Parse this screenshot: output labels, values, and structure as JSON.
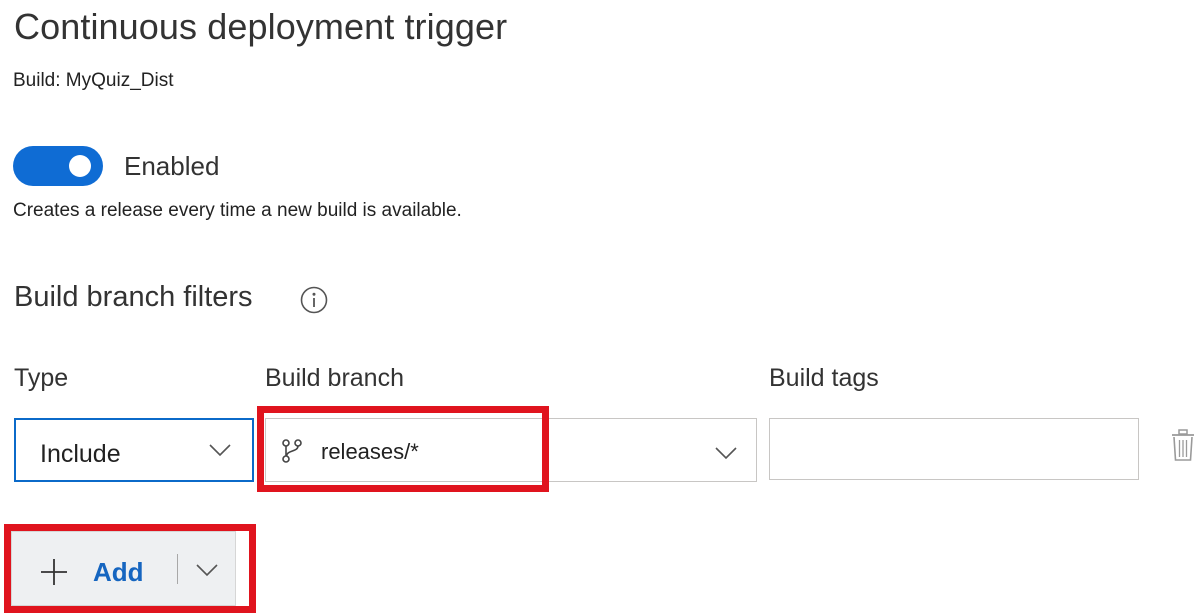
{
  "page": {
    "title": "Continuous deployment trigger",
    "subtitle": "Build: MyQuiz_Dist"
  },
  "trigger": {
    "enabled": true,
    "toggle_label": "Enabled",
    "description": "Creates a release every time a new build is available."
  },
  "filters": {
    "section_title": "Build branch filters",
    "info_icon": "info-icon",
    "columns": {
      "type": "Type",
      "branch": "Build branch",
      "tags": "Build tags"
    },
    "row": {
      "type_value": "Include",
      "branch_value": "releases/*",
      "branch_icon": "git-branch-icon",
      "tags_value": "",
      "delete_icon": "trash-icon"
    }
  },
  "add_button": {
    "label": "Add",
    "icon": "plus-icon",
    "dropdown_icon": "chevron-down-icon"
  },
  "colors": {
    "accent": "#0f6cd4",
    "focus_border": "#0b6ac9",
    "highlight": "#e0141e",
    "add_label": "#1565c0"
  }
}
